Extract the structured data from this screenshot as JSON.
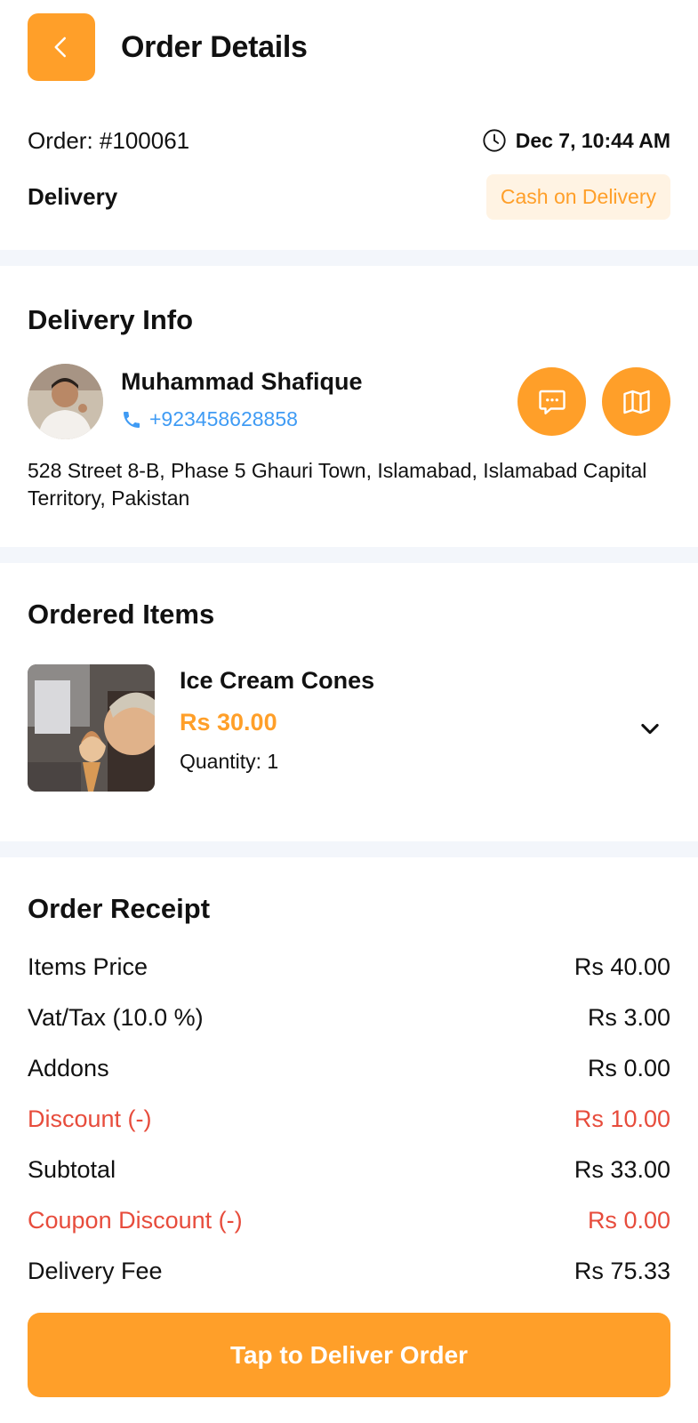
{
  "header": {
    "title": "Order Details",
    "back_icon": "chevron-left-icon"
  },
  "order": {
    "number": "Order: #100061",
    "time": "Dec 7, 10:44 AM",
    "type": "Delivery",
    "payment": "Cash on Delivery"
  },
  "delivery_info": {
    "title": "Delivery Info",
    "name": "Muhammad Shafique",
    "phone": "+923458628858",
    "address": "528 Street 8-B, Phase 5 Ghauri Town, Islamabad, Islamabad Capital Territory, Pakistan"
  },
  "ordered_items": {
    "title": "Ordered Items",
    "items": [
      {
        "name": "Ice Cream Cones",
        "price": "Rs 30.00",
        "quantity": "Quantity: 1"
      }
    ]
  },
  "receipt": {
    "title": "Order Receipt",
    "rows": [
      {
        "label": "Items Price",
        "value": "Rs 40.00"
      },
      {
        "label": "Vat/Tax (10.0 %)",
        "value": "Rs 3.00"
      },
      {
        "label": "Addons",
        "value": "Rs 0.00"
      },
      {
        "label": "Discount (-)",
        "value": "Rs 10.00"
      },
      {
        "label": "Subtotal",
        "value": "Rs 33.00"
      },
      {
        "label": "Coupon Discount (-)",
        "value": "Rs 0.00"
      },
      {
        "label": "Delivery Fee",
        "value": "Rs 75.33"
      }
    ]
  },
  "footer": {
    "button": "Tap to Deliver Order"
  },
  "colors": {
    "accent": "#FF9F29",
    "phone": "#3F9BF4",
    "discount": "#E74C3C",
    "divider": "#F3F6FB"
  }
}
